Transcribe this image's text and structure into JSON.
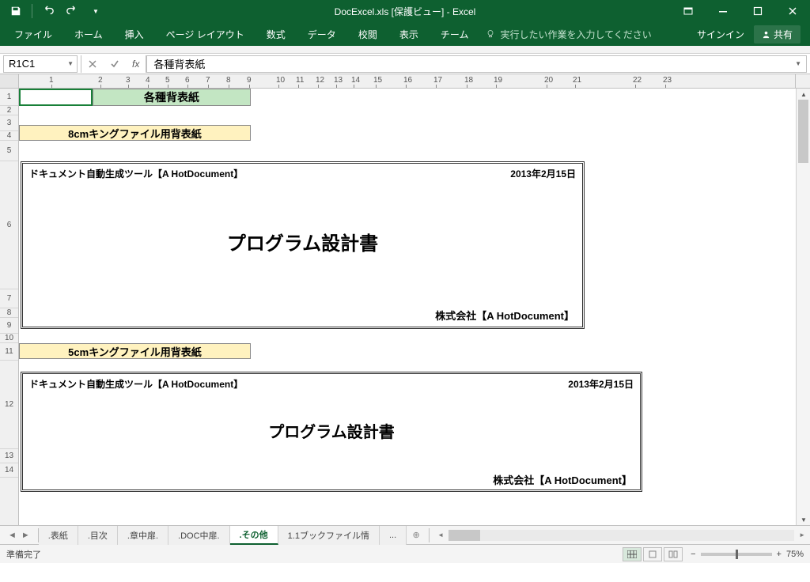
{
  "titlebar": {
    "title": "DocExcel.xls [保護ビュー] - Excel"
  },
  "ribbon": {
    "tabs": [
      "ファイル",
      "ホーム",
      "挿入",
      "ページ レイアウト",
      "数式",
      "データ",
      "校閲",
      "表示",
      "チーム"
    ],
    "tell_me": "実行したい作業を入力してください",
    "signin": "サインイン",
    "share": "共有"
  },
  "formula": {
    "name_box": "R1C1",
    "fx": "fx",
    "value": "各種背表紙"
  },
  "ruler_ticks": [
    "1",
    "2",
    "3",
    "4",
    "5",
    "6",
    "7",
    "8",
    "9",
    "10",
    "11",
    "12",
    "13",
    "14",
    "15",
    "16",
    "17",
    "18",
    "19",
    "20",
    "21",
    "22",
    "23"
  ],
  "rows": [
    "1",
    "2",
    "3",
    "4",
    "5",
    "6",
    "7",
    "8",
    "9",
    "10",
    "11",
    "12",
    "13",
    "14"
  ],
  "content": {
    "title_cell": "各種背表紙",
    "sub1": "8cmキングファイル用背表紙",
    "sub2": "5cmキングファイル用背表紙",
    "doc1": {
      "tool": "ドキュメント自動生成ツール【A HotDocument】",
      "date": "2013年2月15日",
      "main": "プログラム設計書",
      "company": "株式会社【A HotDocument】"
    },
    "doc2": {
      "tool": "ドキュメント自動生成ツール【A HotDocument】",
      "date": "2013年2月15日",
      "main": "プログラム設計書",
      "company": "株式会社【A HotDocument】"
    }
  },
  "sheet_tabs": {
    "items": [
      ".表紙",
      ".目次",
      ".章中扉.",
      ".DOC中扉.",
      ".その他",
      "1.1ブックファイル情",
      "..."
    ],
    "active_index": 4
  },
  "status": {
    "ready": "準備完了",
    "zoom": "75%"
  }
}
